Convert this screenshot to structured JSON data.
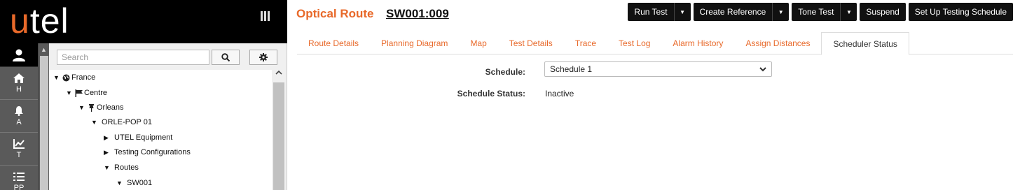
{
  "brand": {
    "logo_u": "u",
    "logo_rest": "tel"
  },
  "rail": {
    "items": [
      {
        "icon": "home-icon",
        "label": "H"
      },
      {
        "icon": "bell-icon",
        "label": "A"
      },
      {
        "icon": "chart-icon",
        "label": "T"
      },
      {
        "icon": "list-icon",
        "label": "PP"
      }
    ]
  },
  "tree_panel": {
    "search_placeholder": "Search",
    "nodes": [
      {
        "label": "France",
        "level": 0
      },
      {
        "label": "Centre",
        "level": 1
      },
      {
        "label": "Orleans",
        "level": 2
      },
      {
        "label": "ORLE-POP 01",
        "level": 3
      },
      {
        "label": "UTEL Equipment",
        "level": 4
      },
      {
        "label": "Testing Configurations",
        "level": 4
      },
      {
        "label": "Routes",
        "level": 4
      },
      {
        "label": "SW001",
        "level": 5
      }
    ]
  },
  "header": {
    "title": "Optical Route",
    "route_id": "SW001:009",
    "buttons": {
      "run_test": "Run Test",
      "create_reference": "Create Reference",
      "tone_test": "Tone Test",
      "suspend": "Suspend",
      "setup_schedule": "Set Up Testing Schedule"
    }
  },
  "tabs": [
    "Route Details",
    "Planning Diagram",
    "Map",
    "Test Details",
    "Trace",
    "Test Log",
    "Alarm History",
    "Assign Distances",
    "Scheduler Status"
  ],
  "scheduler": {
    "schedule_label": "Schedule:",
    "schedule_value": "Schedule 1",
    "status_label": "Schedule Status:",
    "status_value": "Inactive"
  },
  "colors": {
    "accent": "#e8692a",
    "dark": "#111111",
    "rail": "#5a5a5a"
  }
}
